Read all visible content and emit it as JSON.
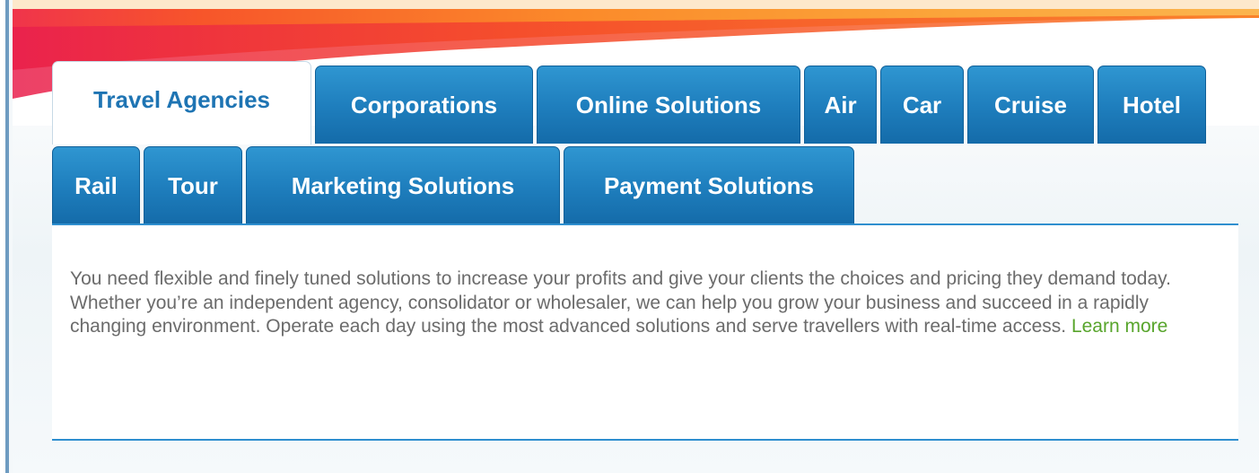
{
  "tabs_row1": [
    {
      "label": "Travel Agencies",
      "active": true
    },
    {
      "label": "Corporations"
    },
    {
      "label": "Online Solutions"
    },
    {
      "label": "Air"
    },
    {
      "label": "Car"
    },
    {
      "label": "Cruise"
    },
    {
      "label": "Hotel"
    }
  ],
  "tabs_row2": [
    {
      "label": "Rail"
    },
    {
      "label": "Tour"
    },
    {
      "label": "Marketing Solutions"
    },
    {
      "label": "Payment Solutions"
    }
  ],
  "content": {
    "body": "You need flexible and finely tuned solutions to increase your profits and give your clients the choices and pricing they demand today. Whether you’re an independent agency, consolidator or wholesaler, we can help you grow your business and succeed in a rapidly changing environment. Operate each day using the most advanced solutions and serve travellers with real-time access.",
    "learn_more": "Learn more"
  },
  "colors": {
    "tab_blue": "#1f7fbe",
    "active_tab_text": "#1e74b3",
    "link_green": "#58a52c",
    "body_text": "#6b6b6b",
    "divider": "#2f8fcf"
  }
}
